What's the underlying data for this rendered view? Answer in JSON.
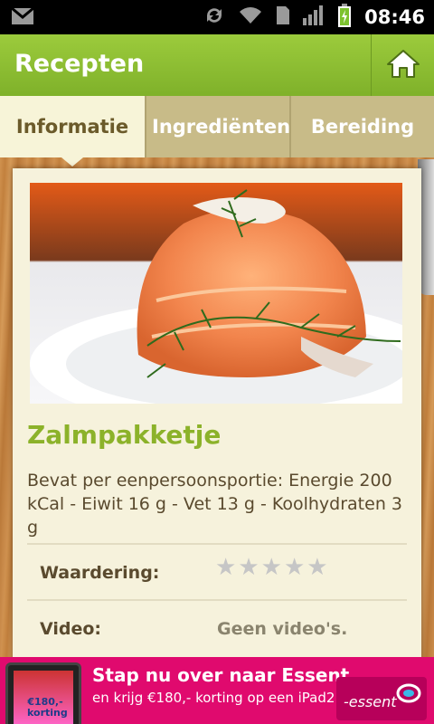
{
  "status_bar": {
    "time": "08:46",
    "icons": [
      "gmail-icon",
      "sync-icon",
      "wifi-icon",
      "sim-icon",
      "signal-icon",
      "battery-charging-icon"
    ]
  },
  "app_bar": {
    "title": "Recepten",
    "home_icon": "home-icon"
  },
  "tabs": [
    {
      "label": "Informatie",
      "active": true
    },
    {
      "label": "Ingrediënten",
      "active": false
    },
    {
      "label": "Bereiding",
      "active": false
    }
  ],
  "recipe": {
    "title": "Zalmpakketje",
    "description": "Bevat per eenpersoonsportie: Energie 200 kCal - Eiwit 16 g - Vet 13 g - Koolhydraten 3 g",
    "rating_label": "Waardering:",
    "rating_value": 0,
    "rating_max": 5,
    "video_label": "Video:",
    "video_value": "Geen video's."
  },
  "ad": {
    "headline": "Stap nu over naar Essent",
    "subline": "en krijg €180,- korting op een iPad2!",
    "badge_text": "€180,- korting",
    "logo_text": "-essent"
  },
  "colors": {
    "app_bar": "#8fbf32",
    "tab_active": "#f7f4d8",
    "tab_inactive": "#c8bb88",
    "title_green": "#8cb22a",
    "ad_pink": "#e00a6e"
  }
}
